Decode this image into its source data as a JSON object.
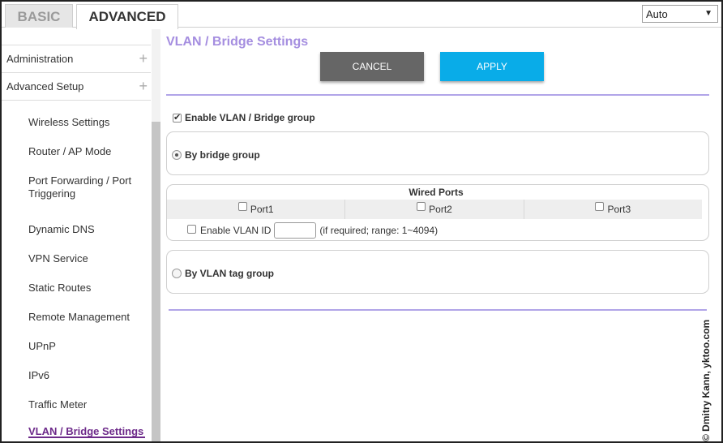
{
  "tabs": {
    "basic": "BASIC",
    "advanced": "ADVANCED"
  },
  "language_select": {
    "value": "Auto"
  },
  "sidebar": {
    "sections": [
      {
        "label": "Administration"
      },
      {
        "label": "Advanced Setup"
      }
    ],
    "items": [
      {
        "label": "Wireless Settings"
      },
      {
        "label": "Router / AP Mode"
      },
      {
        "label": "Port Forwarding / Port Triggering"
      },
      {
        "label": "Dynamic DNS"
      },
      {
        "label": "VPN Service"
      },
      {
        "label": "Static Routes"
      },
      {
        "label": "Remote Management"
      },
      {
        "label": "UPnP"
      },
      {
        "label": "IPv6"
      },
      {
        "label": "Traffic Meter"
      },
      {
        "label": "VLAN / Bridge Settings",
        "active": true
      }
    ]
  },
  "main": {
    "title": "VLAN / Bridge Settings",
    "cancel_label": "CANCEL",
    "apply_label": "APPLY",
    "enable_label": "Enable VLAN / Bridge group",
    "enable_checked": true,
    "by_bridge_group": {
      "label": "By bridge group",
      "selected": true
    },
    "wired_ports": {
      "title": "Wired Ports",
      "ports": [
        {
          "label": "Port1",
          "checked": false
        },
        {
          "label": "Port2",
          "checked": false
        },
        {
          "label": "Port3",
          "checked": false
        }
      ],
      "enable_vlan_id_label": "Enable VLAN ID",
      "vlan_id_value": "",
      "hint": "(if required; range: 1~4094)"
    },
    "by_vlan_tag_group": {
      "label": "By VLAN tag group",
      "selected": false
    }
  },
  "watermark": "© Dmitry Kann, yktoo.com",
  "colors": {
    "title_purple": "#a58ee0",
    "active_purple": "#6d2a8a",
    "apply_blue": "#09ace8",
    "cancel_gray": "#666666",
    "rule_lavender": "#b1a4e8"
  }
}
